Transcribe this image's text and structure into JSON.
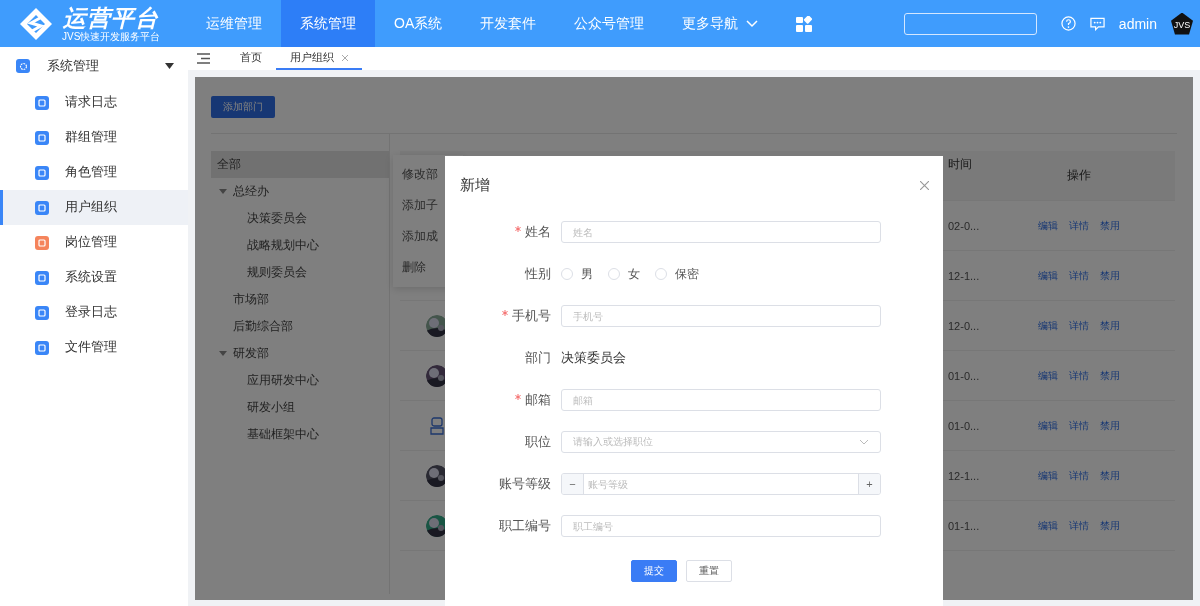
{
  "header": {
    "logo_title": "运营平台",
    "logo_subtitle": "JVS快速开发服务平台",
    "nav": [
      {
        "label": "运维管理",
        "selected": false
      },
      {
        "label": "系统管理",
        "selected": true
      },
      {
        "label": "OA系统",
        "selected": false
      },
      {
        "label": "开发套件",
        "selected": false
      },
      {
        "label": "公众号管理",
        "selected": false
      },
      {
        "label": "更多导航",
        "selected": false,
        "kind": "dropdown"
      }
    ],
    "user": "admin",
    "avatar_text": "JVS"
  },
  "sidebar": {
    "group": {
      "label": "系统管理",
      "expanded": true
    },
    "items": [
      {
        "label": "请求日志",
        "selected": false,
        "color": "#3a86f7"
      },
      {
        "label": "群组管理",
        "selected": false,
        "color": "#3a86f7"
      },
      {
        "label": "角色管理",
        "selected": false,
        "color": "#3a86f7"
      },
      {
        "label": "用户组织",
        "selected": true,
        "color": "#3a86f7"
      },
      {
        "label": "岗位管理",
        "selected": false,
        "color": "#f5845c"
      },
      {
        "label": "系统设置",
        "selected": false,
        "color": "#3a86f7"
      },
      {
        "label": "登录日志",
        "selected": false,
        "color": "#3a86f7"
      },
      {
        "label": "文件管理",
        "selected": false,
        "color": "#3a86f7"
      }
    ]
  },
  "tabs": [
    {
      "label": "首页",
      "selected": false,
      "closable": false
    },
    {
      "label": "用户组织",
      "selected": true,
      "closable": true
    }
  ],
  "page": {
    "add_button": "添加部门",
    "tree": [
      {
        "label": "全部",
        "selected": true
      },
      {
        "label": "总经办",
        "selected": false,
        "expanded": true,
        "children": [
          {
            "label": "决策委员会",
            "selected": false
          },
          {
            "label": "战略规划中心",
            "selected": false
          },
          {
            "label": "规则委员会",
            "selected": false
          }
        ]
      },
      {
        "label": "市场部",
        "selected": false
      },
      {
        "label": "后勤综合部",
        "selected": false
      },
      {
        "label": "研发部",
        "selected": false,
        "expanded": true,
        "children": [
          {
            "label": "应用研发中心",
            "selected": false
          },
          {
            "label": "研发小组",
            "selected": false
          },
          {
            "label": "基础框架中心",
            "selected": false
          }
        ]
      }
    ],
    "context_menu": [
      "修改部",
      "添加子",
      "添加成",
      "删除"
    ],
    "table": {
      "columns": [
        "时间",
        "操作"
      ],
      "rows": [
        {
          "time": "02-0...",
          "actions": [
            "编辑",
            "详情",
            "禁用"
          ]
        },
        {
          "time": "12-1...",
          "actions": [
            "编辑",
            "详情",
            "禁用"
          ]
        },
        {
          "kind": "picture",
          "time": "12-0...",
          "actions": [
            "编辑",
            "详情",
            "禁用"
          ]
        },
        {
          "kind": "picture",
          "time": "01-0...",
          "actions": [
            "编辑",
            "详情",
            "禁用"
          ]
        },
        {
          "kind": "icon",
          "time": "01-0...",
          "actions": [
            "编辑",
            "详情",
            "禁用"
          ]
        },
        {
          "kind": "picture",
          "time": "12-1...",
          "actions": [
            "编辑",
            "详情",
            "禁用"
          ]
        },
        {
          "kind": "picture",
          "time": "01-1...",
          "actions": [
            "编辑",
            "详情",
            "禁用"
          ]
        }
      ]
    }
  },
  "dialog": {
    "title": "新增",
    "fields": [
      {
        "kind": "input",
        "label": "姓名",
        "required": true,
        "placeholder": "姓名"
      },
      {
        "kind": "radio",
        "label": "性别",
        "required": false,
        "options": [
          {
            "label": "男",
            "selected": false
          },
          {
            "label": "女",
            "selected": false
          },
          {
            "label": "保密",
            "selected": false
          }
        ]
      },
      {
        "kind": "input",
        "label": "手机号",
        "required": true,
        "placeholder": "手机号"
      },
      {
        "kind": "text",
        "label": "部门",
        "required": false,
        "value": "决策委员会"
      },
      {
        "kind": "input",
        "label": "邮箱",
        "required": true,
        "placeholder": "邮箱"
      },
      {
        "kind": "select",
        "label": "职位",
        "required": false,
        "placeholder": "请输入或选择职位"
      },
      {
        "kind": "number",
        "label": "账号等级",
        "required": false,
        "placeholder": "账号等级",
        "minus": "−",
        "plus": "+"
      },
      {
        "kind": "input",
        "label": "职工编号",
        "required": false,
        "placeholder": "职工编号"
      }
    ],
    "buttons": [
      {
        "label": "提交",
        "primary": true
      },
      {
        "label": "重置",
        "primary": false
      }
    ]
  }
}
